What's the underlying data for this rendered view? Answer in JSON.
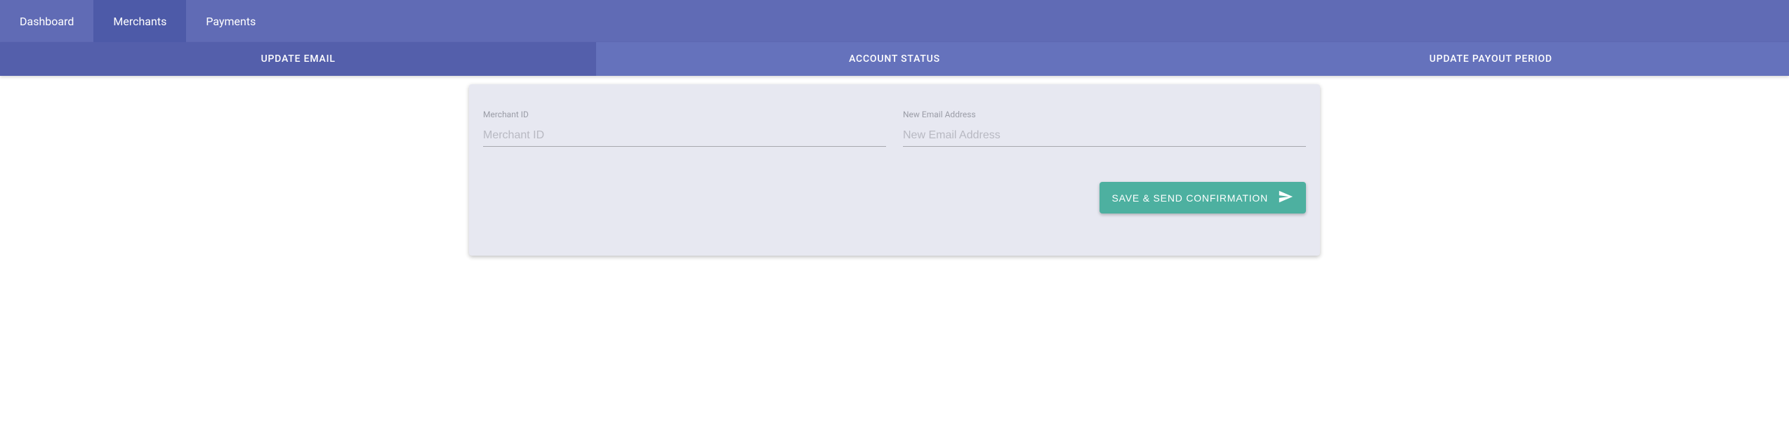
{
  "topnav": {
    "items": [
      {
        "label": "Dashboard"
      },
      {
        "label": "Merchants"
      },
      {
        "label": "Payments"
      }
    ],
    "active_index": 1
  },
  "subnav": {
    "tabs": [
      {
        "label": "UPDATE EMAIL"
      },
      {
        "label": "ACCOUNT STATUS"
      },
      {
        "label": "UPDATE PAYOUT PERIOD"
      }
    ],
    "active_index": 0
  },
  "form": {
    "merchant_id": {
      "label": "Merchant ID",
      "placeholder": "Merchant ID",
      "value": ""
    },
    "new_email": {
      "label": "New Email Address",
      "placeholder": "New Email Address",
      "value": ""
    },
    "save_button_label": "SAVE & SEND CONFIRMATION"
  },
  "colors": {
    "topnav_bg": "#606bb5",
    "topnav_active_bg": "#4d5aa8",
    "subnav_bg": "#6572bc",
    "subnav_active_bg": "#545fab",
    "card_bg": "#e7e8f1",
    "button_bg": "#4db0a0"
  }
}
